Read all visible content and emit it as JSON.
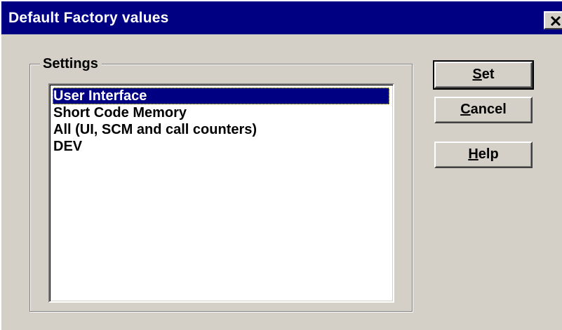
{
  "window": {
    "title": "Default Factory values",
    "close_glyph": "✕"
  },
  "settings": {
    "group_label": "Settings",
    "items": [
      {
        "label": "User Interface",
        "selected": true
      },
      {
        "label": "Short Code Memory",
        "selected": false
      },
      {
        "label": "All (UI, SCM and call counters)",
        "selected": false
      },
      {
        "label": "DEV",
        "selected": false
      }
    ]
  },
  "buttons": {
    "set": {
      "mnemonic": "S",
      "rest": "et"
    },
    "cancel": {
      "mnemonic": "C",
      "rest": "ancel"
    },
    "help": {
      "mnemonic": "H",
      "rest": "elp"
    }
  }
}
